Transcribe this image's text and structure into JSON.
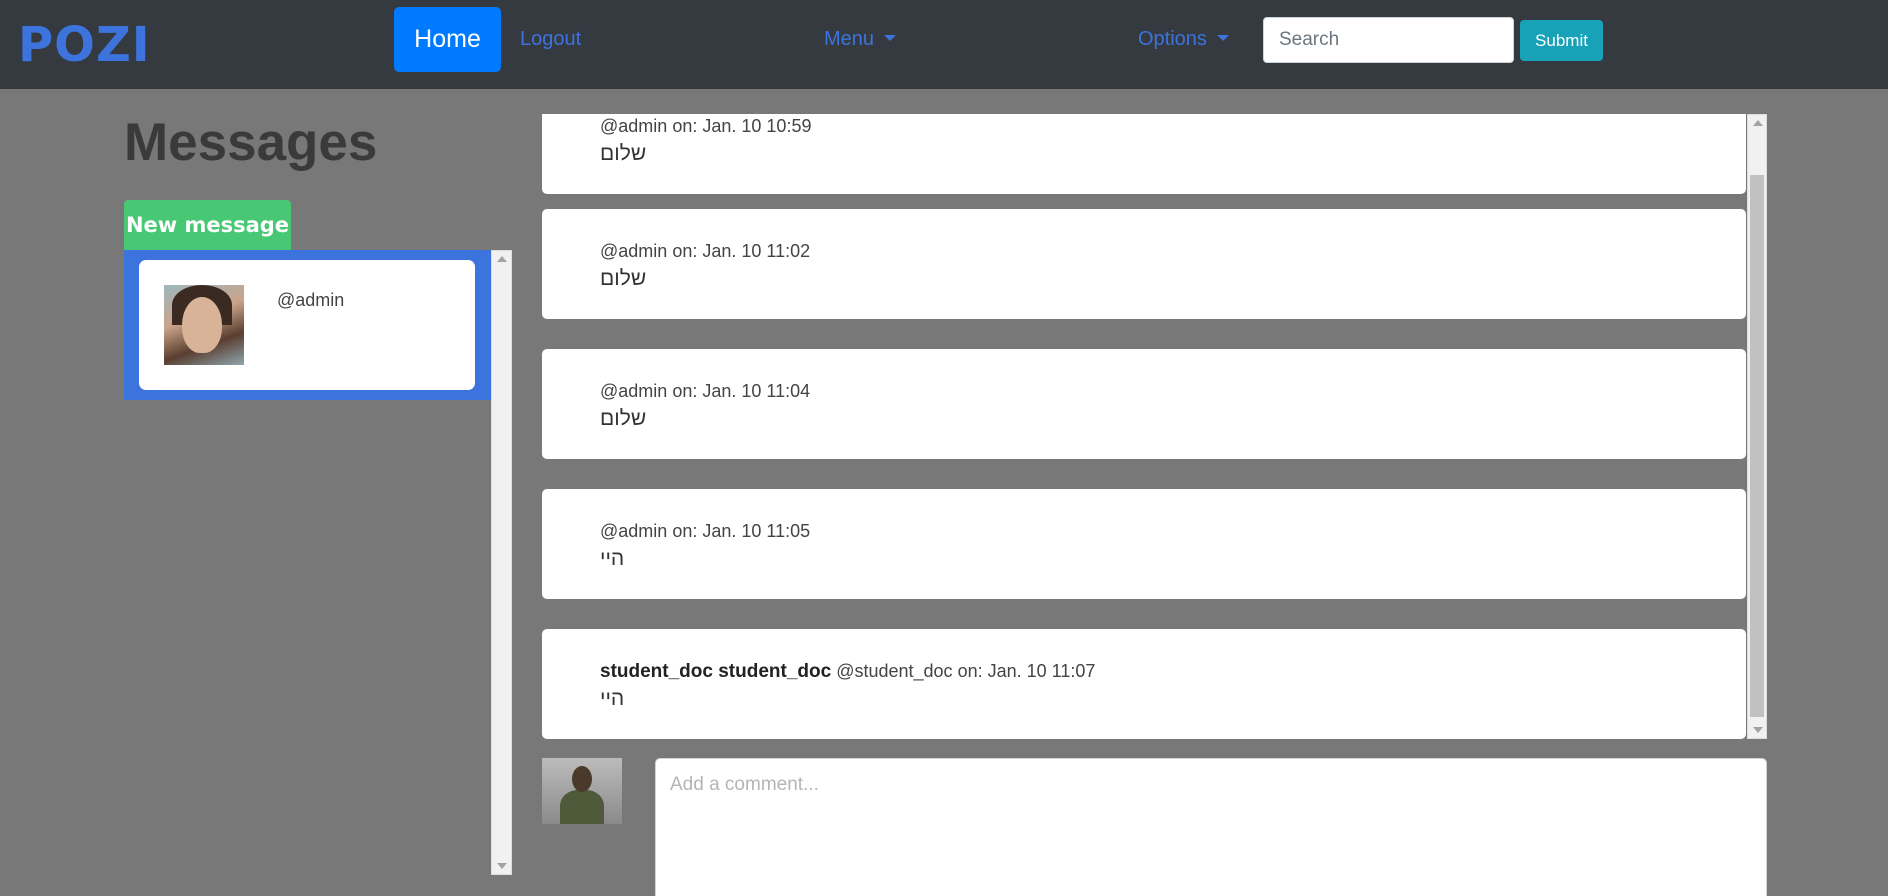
{
  "navbar": {
    "brand": "POZI",
    "home_label": "Home",
    "logout_label": "Logout",
    "menu_label": "Menu",
    "options_label": "Options",
    "search_placeholder": "Search",
    "submit_label": "Submit"
  },
  "sidebar": {
    "title": "Messages",
    "new_message_label": "New message",
    "contacts": [
      {
        "handle": "@admin"
      }
    ]
  },
  "messages": [
    {
      "author_name": "",
      "handle": "@admin",
      "on": "on:",
      "time": "Jan. 10 10:59",
      "text": "שלום"
    },
    {
      "author_name": "",
      "handle": "@admin",
      "on": "on:",
      "time": "Jan. 10 11:02",
      "text": "שלום"
    },
    {
      "author_name": "",
      "handle": "@admin",
      "on": "on:",
      "time": "Jan. 10 11:04",
      "text": "שלום"
    },
    {
      "author_name": "",
      "handle": "@admin",
      "on": "on:",
      "time": "Jan. 10 11:05",
      "text": "היי"
    },
    {
      "author_name": "student_doc student_doc",
      "handle": "@student_doc",
      "on": "on:",
      "time": "Jan. 10 11:07",
      "text": "היי"
    }
  ],
  "comment": {
    "placeholder": "Add a comment..."
  },
  "colors": {
    "navbar_bg": "#343a40",
    "brand": "#3d73dc",
    "home_active": "#007bff",
    "submit": "#17a2b8",
    "new_message": "#48c774",
    "page_bg": "#787878"
  }
}
